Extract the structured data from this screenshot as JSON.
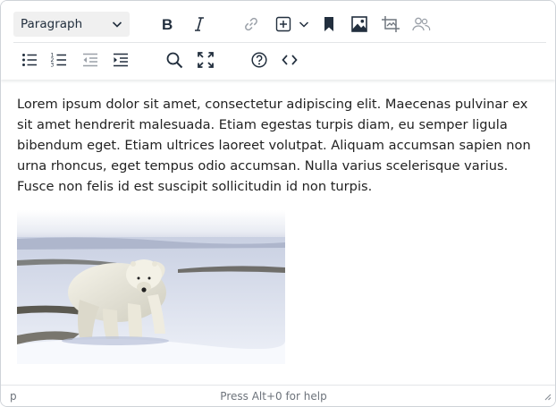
{
  "toolbar": {
    "block_format": "Paragraph",
    "icons_row1": [
      "bold-icon",
      "italic-icon",
      "link-icon",
      "insert-plus-icon",
      "chevron-down-icon",
      "bookmark-icon",
      "image-icon",
      "crop-icon",
      "users-icon"
    ],
    "icons_row2": [
      "bullet-list-icon",
      "numbered-list-icon",
      "outdent-icon",
      "indent-icon",
      "search-icon",
      "fullscreen-icon",
      "help-icon",
      "code-icon"
    ]
  },
  "content": {
    "paragraph": "Lorem ipsum dolor sit amet, consectetur adipiscing elit. Maecenas pulvinar ex sit amet hendrerit malesuada. Etiam egestas turpis diam, eu semper ligula bibendum eget. Etiam ultrices laoreet volutpat. Aliquam accumsan sapien non urna rhoncus, eget tempus odio accumsan. Nulla varius scelerisque varius. Fusce non felis id est suscipit sollicitudin id non turpis.",
    "image": "polar-bear-photo"
  },
  "statusbar": {
    "path": "p",
    "help_text": "Press Alt+0 for help"
  },
  "colors": {
    "icon": "#222f3e",
    "disabled_icon": "#9aa0a8",
    "border": "#cfd3d8",
    "select_bg": "#f0f0f0"
  }
}
